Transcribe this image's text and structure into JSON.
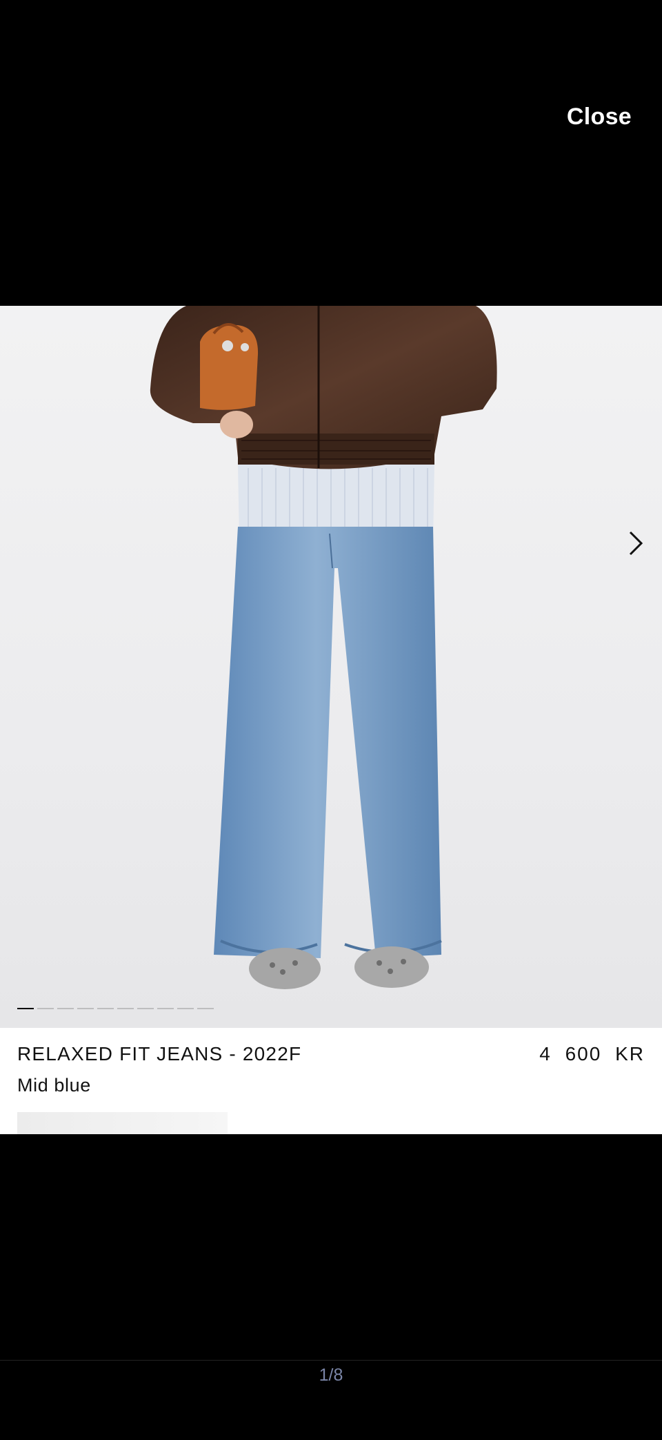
{
  "viewer": {
    "close_label": "Close",
    "counter": "1/8",
    "gallery_total": 10,
    "gallery_active": 1
  },
  "product": {
    "title": "RELAXED FIT JEANS - 2022F",
    "price": "4 600 KR",
    "color": "Mid blue"
  },
  "colors": {
    "background": "#000000",
    "card": "#ffffff",
    "text": "#111111",
    "counter": "#7b86a8",
    "denim": "#6f98c4",
    "jacket": "#4a2f22",
    "bag": "#c56a2c"
  },
  "icons": {
    "next": "chevron-right-icon"
  }
}
